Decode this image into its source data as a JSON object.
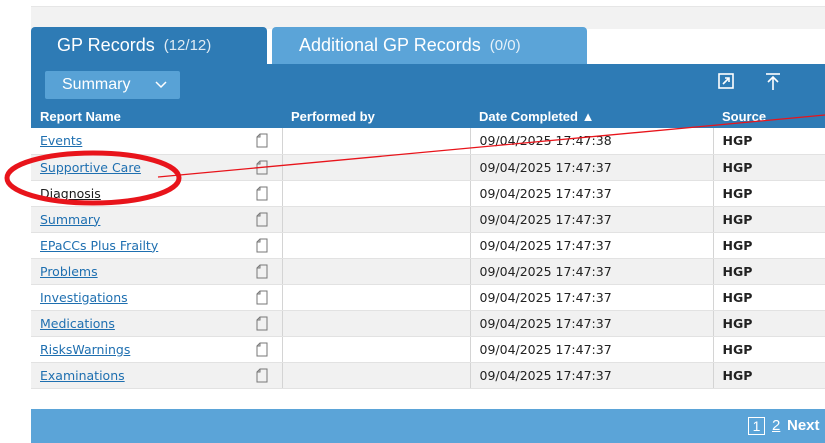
{
  "tabs": [
    {
      "label": "GP Records",
      "count": "(12/12)",
      "active": true
    },
    {
      "label": "Additional GP Records",
      "count": "(0/0)",
      "active": false
    }
  ],
  "toolbar": {
    "view_label": "Summary",
    "view_icon": "chevron-down-icon",
    "actions": [
      "expand-icon",
      "scroll-top-icon"
    ]
  },
  "table": {
    "columns": [
      "Report Name",
      "Performed by",
      "Date Completed ▲",
      "Source"
    ],
    "rows": [
      {
        "name": "Events",
        "performed_by": "",
        "date": "09/04/2025 17:47:38",
        "source": "HGP"
      },
      {
        "name": "Supportive Care",
        "performed_by": "",
        "date": "09/04/2025 17:47:37",
        "source": "HGP"
      },
      {
        "name": "Diagnosis",
        "performed_by": "",
        "date": "09/04/2025 17:47:37",
        "source": "HGP"
      },
      {
        "name": "Summary",
        "performed_by": "",
        "date": "09/04/2025 17:47:37",
        "source": "HGP"
      },
      {
        "name": "EPaCCs Plus Frailty",
        "performed_by": "",
        "date": "09/04/2025 17:47:37",
        "source": "HGP"
      },
      {
        "name": "Problems",
        "performed_by": "",
        "date": "09/04/2025 17:47:37",
        "source": "HGP"
      },
      {
        "name": "Investigations",
        "performed_by": "",
        "date": "09/04/2025 17:47:37",
        "source": "HGP"
      },
      {
        "name": "Medications",
        "performed_by": "",
        "date": "09/04/2025 17:47:37",
        "source": "HGP"
      },
      {
        "name": "RisksWarnings",
        "performed_by": "",
        "date": "09/04/2025 17:47:37",
        "source": "HGP"
      },
      {
        "name": "Examinations",
        "performed_by": "",
        "date": "09/04/2025 17:47:37",
        "source": "HGP"
      }
    ]
  },
  "pagination": {
    "current": "1",
    "other": "2",
    "next": "Next"
  },
  "colors": {
    "header_blue": "#2e7bb5",
    "tab_light_blue": "#5ba4d8",
    "link_blue": "#1e6fb0",
    "annotation_red": "#e8141b"
  }
}
